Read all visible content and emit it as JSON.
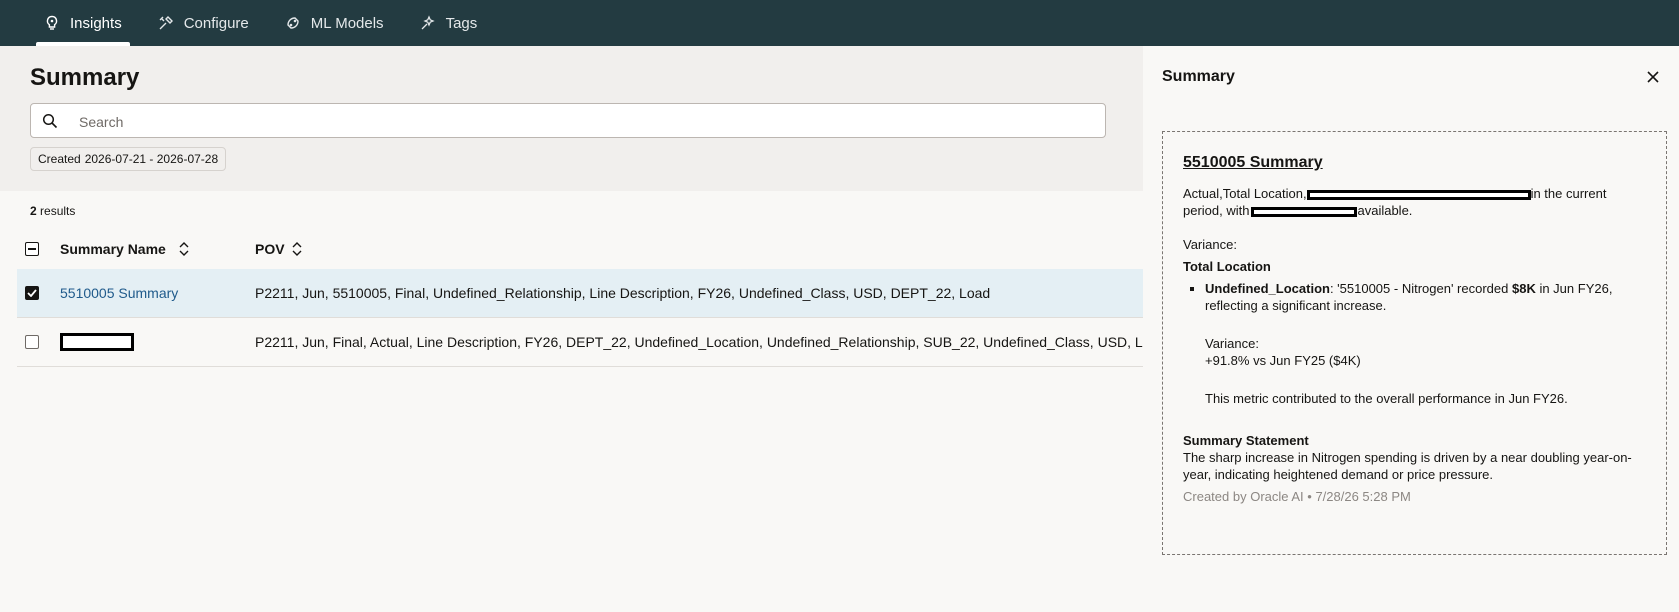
{
  "nav": {
    "tabs": [
      {
        "label": "Insights",
        "icon": "lightbulb-icon",
        "active": true
      },
      {
        "label": "Configure",
        "icon": "tools-icon",
        "active": false
      },
      {
        "label": "ML Models",
        "icon": "ml-models-icon",
        "active": false
      },
      {
        "label": "Tags",
        "icon": "tag-icon",
        "active": false
      }
    ]
  },
  "main": {
    "title": "Summary",
    "search": {
      "placeholder": "Search",
      "value": ""
    },
    "filter_chip": {
      "label": "Created",
      "value": "2026-07-21 - 2026-07-28"
    },
    "results": {
      "count": "2",
      "suffix": "results"
    },
    "table": {
      "columns": [
        "Summary Name",
        "POV"
      ],
      "rows": [
        {
          "name": "5510005 Summary",
          "pov": "P2211, Jun, 5510005, Final, Undefined_Relationship, Line Description, FY26, Undefined_Class, USD, DEPT_22, Load",
          "checked": true
        },
        {
          "name": "",
          "pov": "P2211, Jun, Final, Actual, Line Description, FY26, DEPT_22, Undefined_Location, Undefined_Relationship, SUB_22, Undefined_Class, USD, Load",
          "checked": false
        }
      ]
    }
  },
  "panel": {
    "title": "Summary",
    "card": {
      "heading": "5510005 Summary",
      "intro_part1": "Actual,Total Location,",
      "intro_part2": "in the current",
      "intro_part3": "period, with",
      "intro_part4": "available.",
      "variance_label": "Variance:",
      "section_title": "Total Location",
      "bullet_bold": "Undefined_Location",
      "bullet_text1": ": '5510005 - Nitrogen' recorded ",
      "bullet_amount": "$8K",
      "bullet_text2": " in Jun FY26, reflecting a significant increase.",
      "metric_variance_label": "Variance:",
      "metric_variance_value": "+91.8% vs Jun FY25 ($4K)",
      "contribution": "This metric contributed to the overall performance in Jun FY26.",
      "statement_title": "Summary Statement",
      "statement_text": "The sharp increase in Nitrogen spending is driven by a near doubling year-on-year, indicating heightened demand or price pressure.",
      "created_by": "Created by Oracle AI • 7/28/26 5:28 PM"
    }
  }
}
